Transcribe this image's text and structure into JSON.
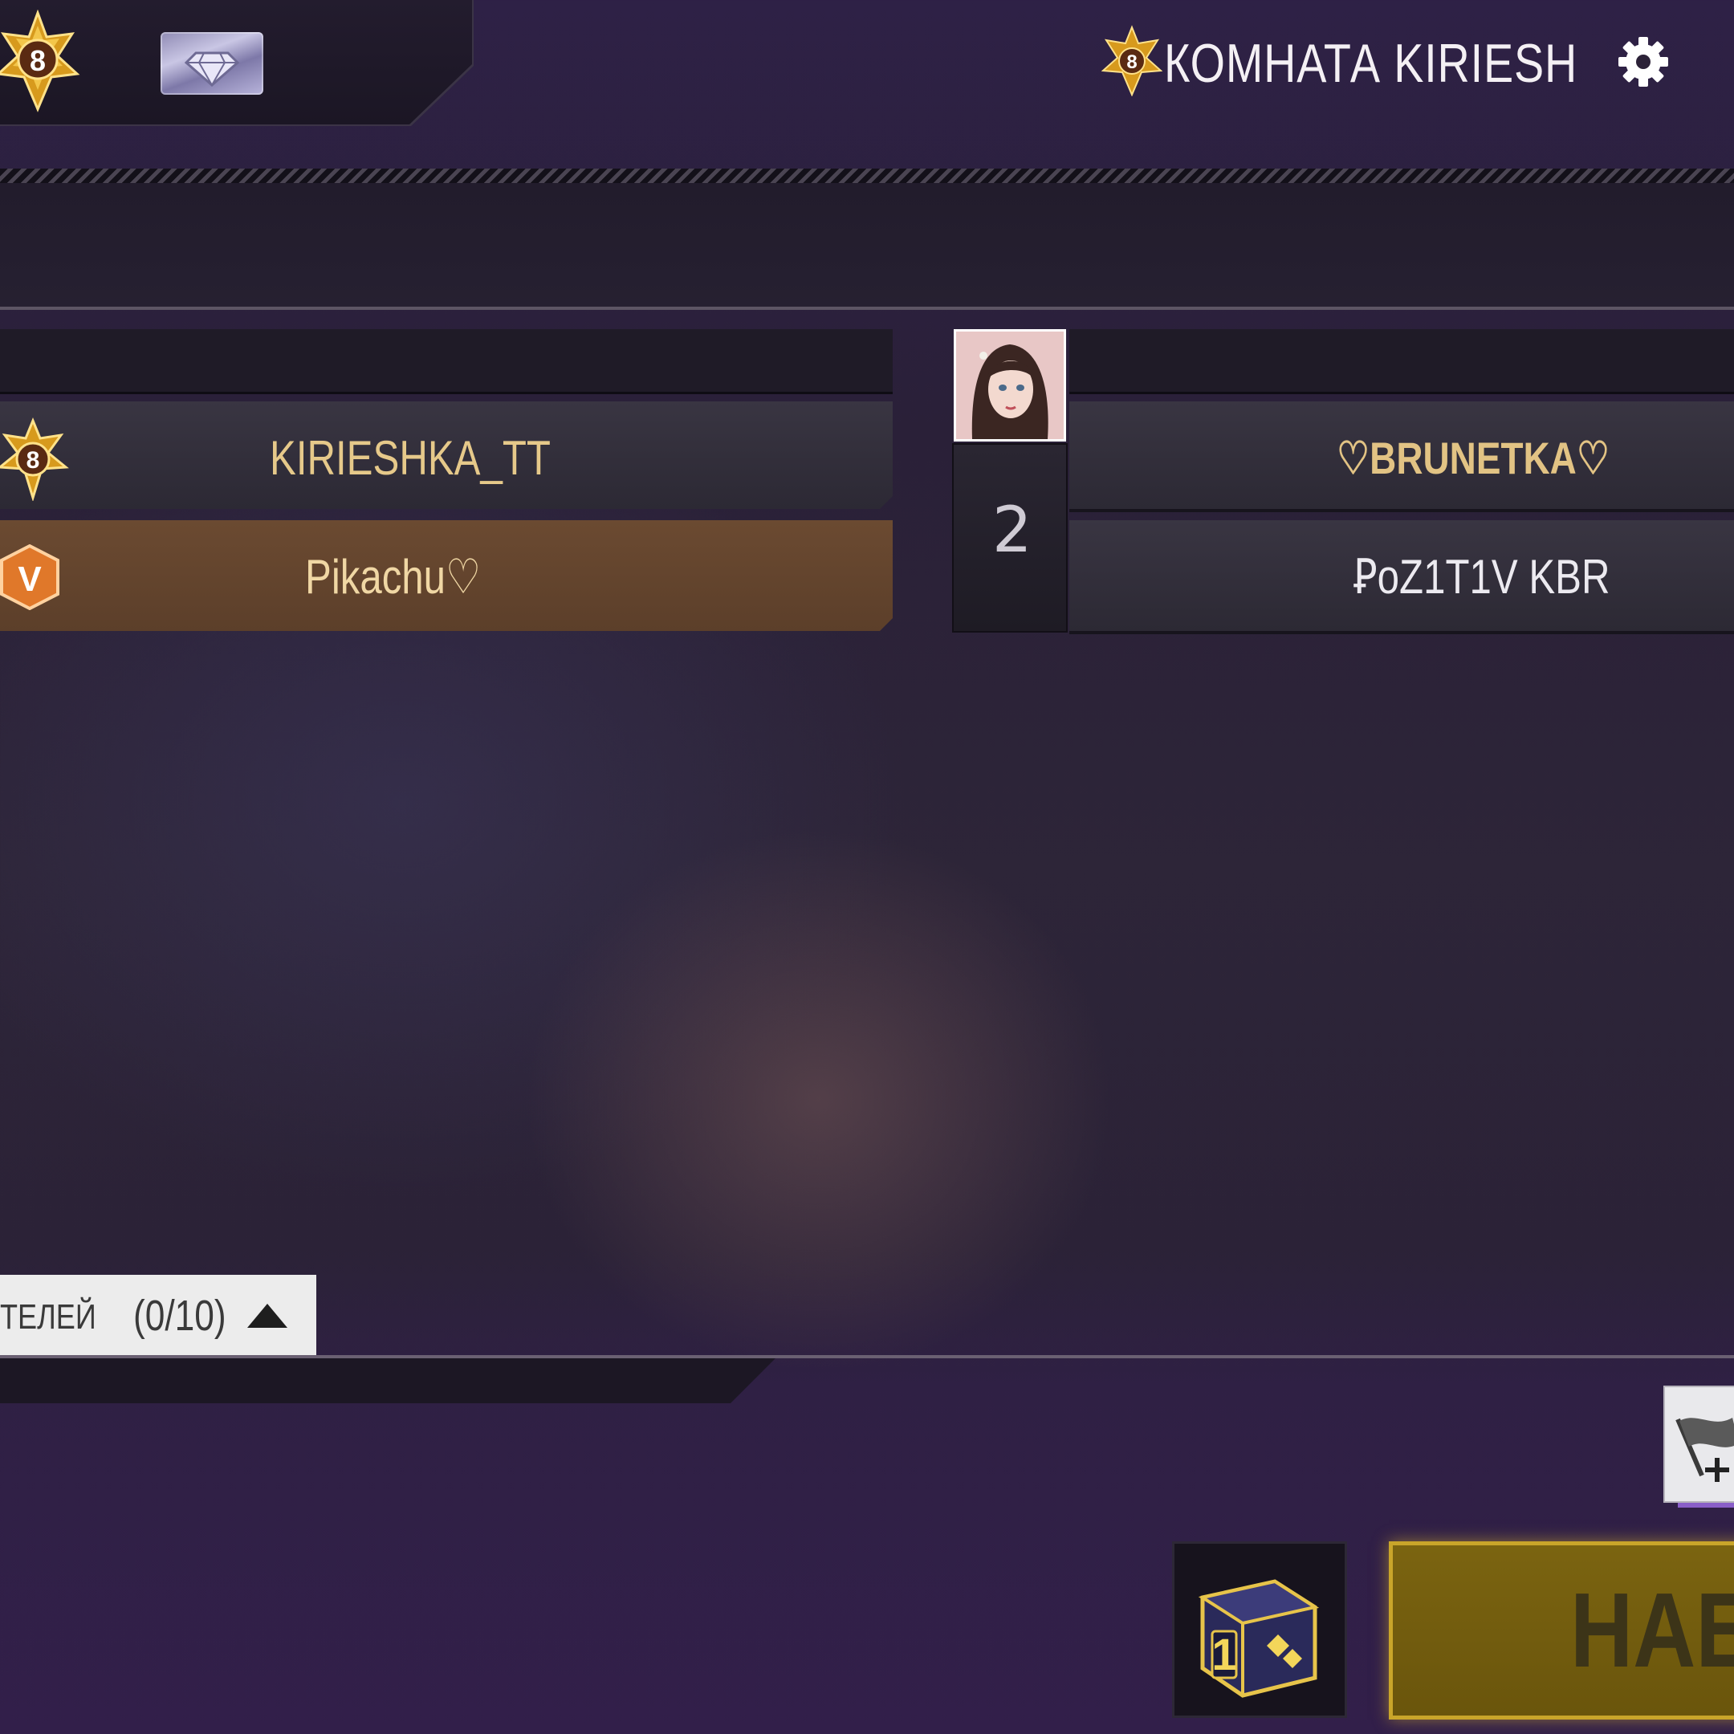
{
  "header": {
    "rank_level": "8",
    "room_title": "КОМНАТА KIRIESH"
  },
  "team_left": {
    "players": [
      {
        "name": "KIRIESHKA_TT",
        "badge": "8"
      },
      {
        "name": "Pikachu♡",
        "badge": "V"
      }
    ]
  },
  "team_right": {
    "slot_number": "2",
    "players": [
      {
        "name": "♡BRUNETKA♡"
      },
      {
        "name": "ꝐoZ1T1V  KBR"
      }
    ]
  },
  "spectators": {
    "label": "ТЕЛЕЙ",
    "count": "(0/10)"
  },
  "bottom": {
    "dice_count": "1",
    "start_label": "НАБ"
  },
  "colors": {
    "gold_name": "#e6c98a",
    "highlight_row": "#6b4a31",
    "start_button": "#7b6410",
    "accent_purple": "#8a5fc9"
  }
}
